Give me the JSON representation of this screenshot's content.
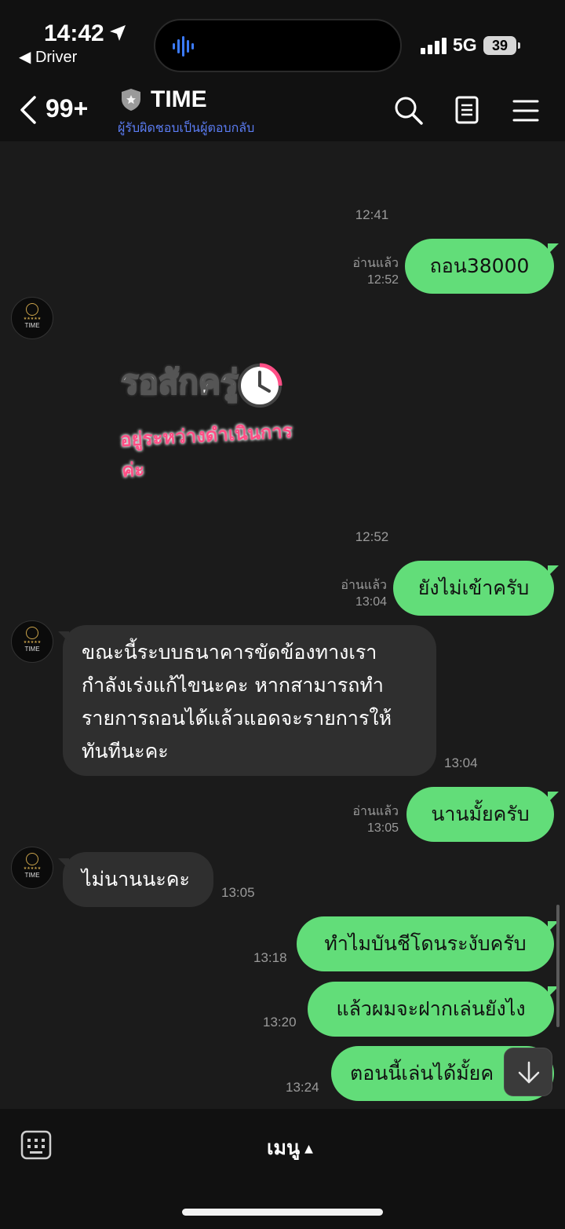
{
  "status_bar": {
    "time": "14:42",
    "back_app": "Driver",
    "network": "5G",
    "battery": "39"
  },
  "header": {
    "unread_count": "99+",
    "title": "TIME",
    "subtitle": "ผู้รับผิดชอบเป็นผู้ตอบกลับ"
  },
  "sticker": {
    "line1": "รอสักครู่",
    "line2": "อยู่ระหว่างดำเนินการค่ะ"
  },
  "messages": [
    {
      "type": "timestamp",
      "time": "12:41"
    },
    {
      "type": "out",
      "text": "ถอน38000",
      "read": "อ่านแล้ว",
      "time": "12:52"
    },
    {
      "type": "sticker",
      "time": "12:52"
    },
    {
      "type": "out",
      "text": "ยังไม่เข้าครับ",
      "read": "อ่านแล้ว",
      "time": "13:04"
    },
    {
      "type": "in",
      "lines": [
        "ขณะนี้ระบบธนาคารขัดข้องทางเรา",
        "กำลังเร่งแก้ไขนะคะ หากสามารถทำ",
        "รายการถอนได้แล้วแอดจะรายการให้",
        "ทันทีนะคะ"
      ],
      "time": "13:04"
    },
    {
      "type": "out",
      "text": "นานมั้ยครับ",
      "read": "อ่านแล้ว",
      "time": "13:05"
    },
    {
      "type": "in",
      "text": "ไม่นานนะคะ",
      "time": "13:05"
    },
    {
      "type": "out",
      "text": "ทำไมบันชีโดนระงับครับ",
      "time": "13:18"
    },
    {
      "type": "out",
      "text": "แล้วผมจะฝากเล่นยังไง",
      "time": "13:20"
    },
    {
      "type": "out",
      "text": "ตอนนี้เล่นได้มั้ยค",
      "time": "13:24"
    }
  ],
  "avatar": {
    "stars": "★★★★★",
    "label": "TIME"
  },
  "bottom_bar": {
    "menu_label": "เมนู"
  },
  "colors": {
    "outgoing": "#62dd79",
    "incoming": "#2f2f2f",
    "subtitle": "#5b7cf2",
    "background": "#1b1b1b"
  }
}
